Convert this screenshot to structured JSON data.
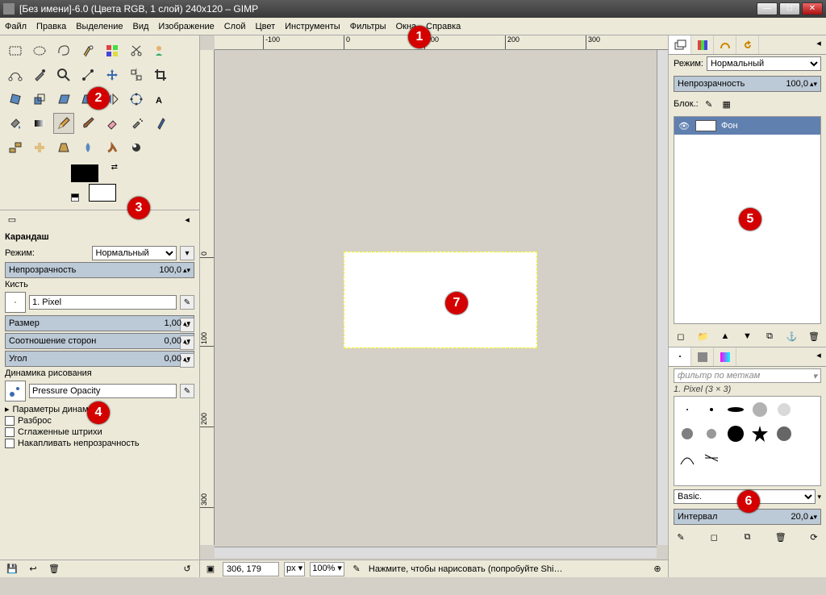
{
  "window": {
    "title": "[Без имени]-6.0 (Цвета RGB, 1 слой) 240x120 – GIMP"
  },
  "menu": {
    "file": "Файл",
    "edit": "Правка",
    "select": "Выделение",
    "view": "Вид",
    "image": "Изображение",
    "layer": "Слой",
    "colors": "Цвет",
    "tools": "Инструменты",
    "filters": "Фильтры",
    "windows": "Окна",
    "help": "Справка"
  },
  "tooloptions": {
    "title": "Карандаш",
    "mode_label": "Режим:",
    "mode_value": "Нормальный",
    "opacity_label": "Непрозрачность",
    "opacity_value": "100,0",
    "brush_label": "Кисть",
    "brush_name": "1. Pixel",
    "size_label": "Размер",
    "size_value": "1,00",
    "ratio_label": "Соотношение сторон",
    "ratio_value": "0,00",
    "angle_label": "Угол",
    "angle_value": "0,00",
    "dynamics_label": "Динамика рисования",
    "dynamics_value": "Pressure Opacity",
    "dynamics_params": "Параметры динамики",
    "scatter": "Разброс",
    "smooth": "Сглаженные штрихи",
    "accumulate": "Накапливать непрозрачность"
  },
  "layers": {
    "mode_label": "Режим:",
    "mode_value": "Нормальный",
    "opacity_label": "Непрозрачность",
    "opacity_value": "100,0",
    "lock_label": "Блок.:",
    "layer_name": "Фон"
  },
  "brushes": {
    "filter_placeholder": "фильтр по меткам",
    "current": "1. Pixel (3 × 3)",
    "preset": "Basic.",
    "interval_label": "Интервал",
    "interval_value": "20,0"
  },
  "status": {
    "coords": "306, 179",
    "unit": "px",
    "zoom": "100%",
    "hint": "Нажмите, чтобы нарисовать (попробуйте Shi…"
  },
  "ruler": {
    "h": [
      "-100",
      "0",
      "100",
      "200",
      "300"
    ],
    "v": [
      "0",
      "100",
      "200",
      "300"
    ]
  },
  "badges": [
    "1",
    "2",
    "3",
    "4",
    "5",
    "6",
    "7"
  ]
}
